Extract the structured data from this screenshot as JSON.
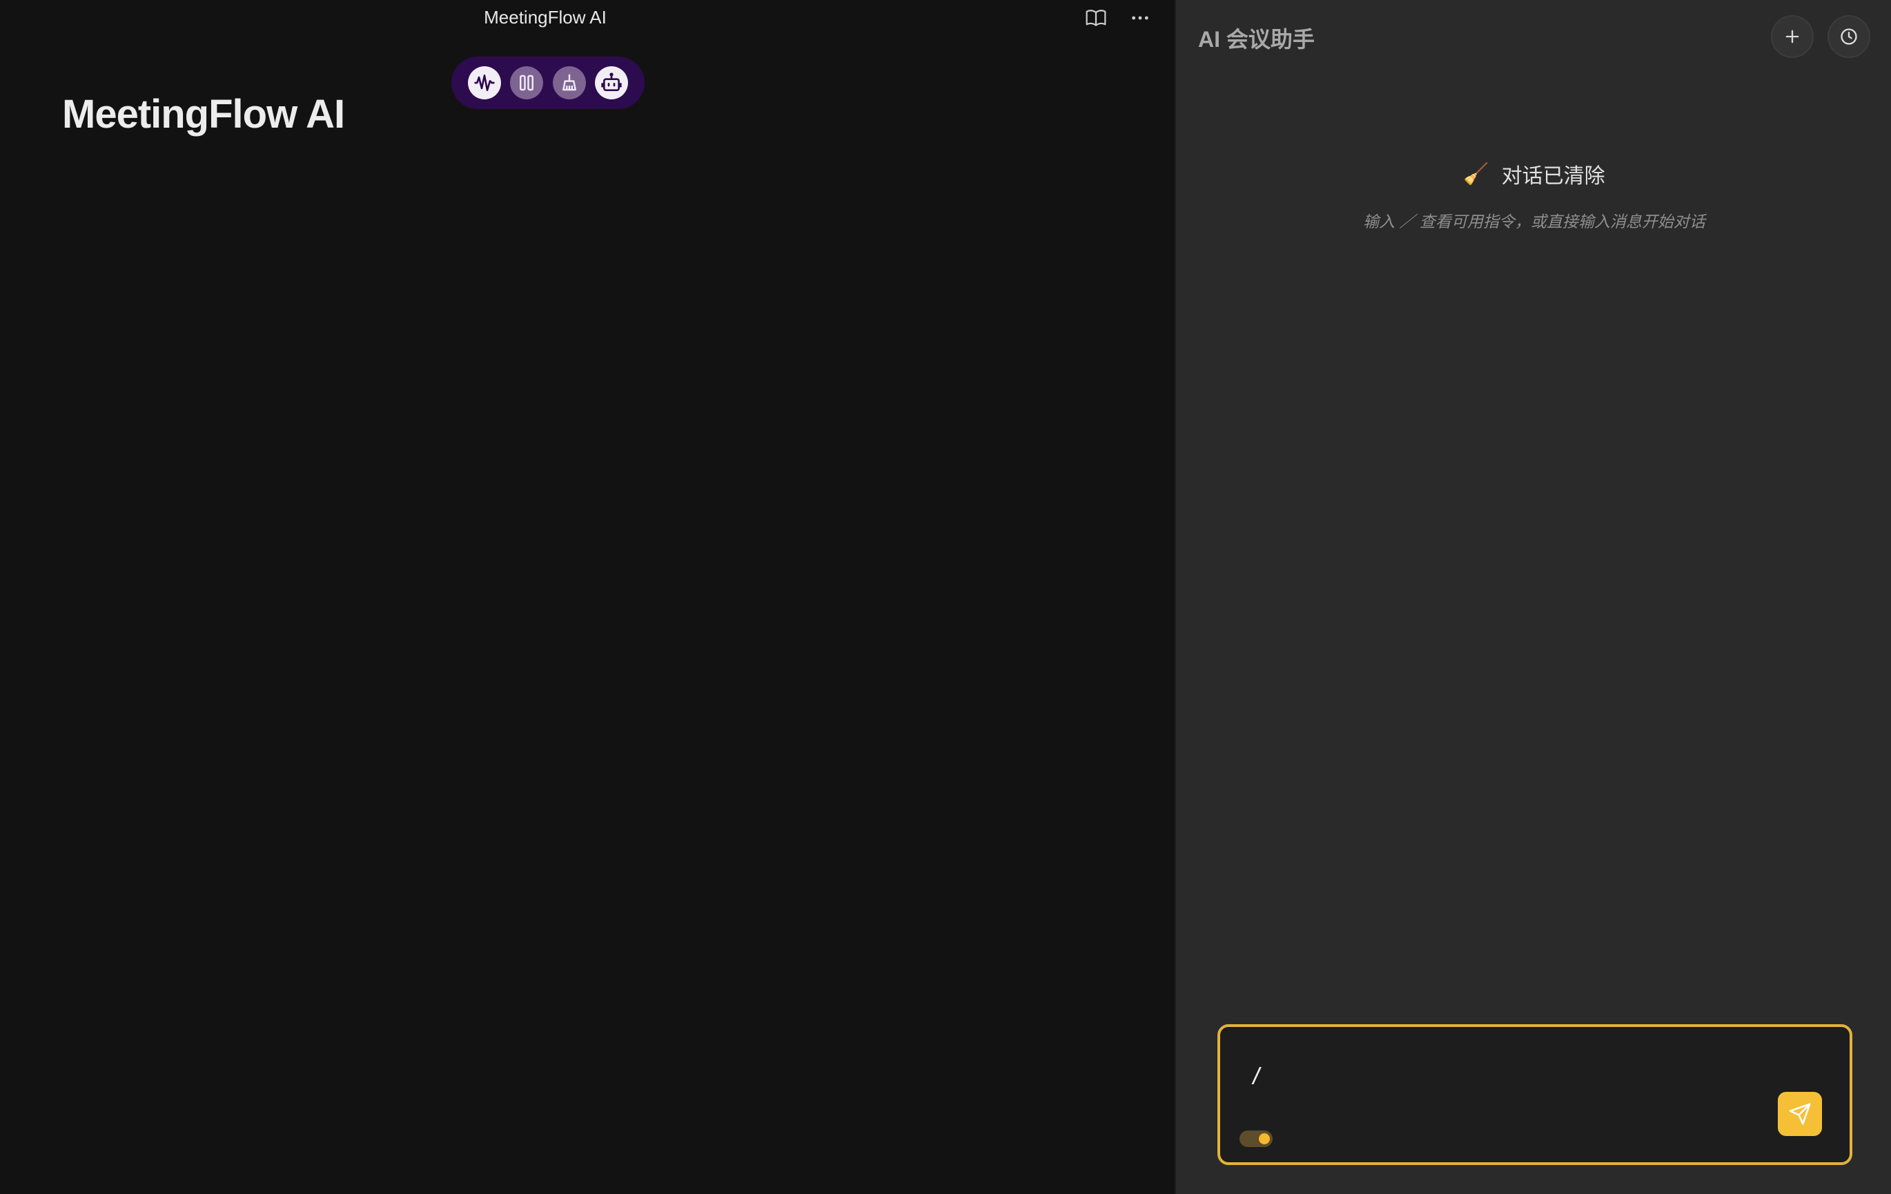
{
  "window": {
    "title": "MeetingFlow AI"
  },
  "editor": {
    "doc_title": "MeetingFlow AI",
    "top_actions": [
      {
        "icon": "book-open-icon"
      },
      {
        "icon": "more-horizontal-icon"
      }
    ],
    "toolbar": [
      {
        "icon": "audio-waveform-icon",
        "state": "active"
      },
      {
        "icon": "pause-icon",
        "state": "dim"
      },
      {
        "icon": "broom-icon",
        "state": "dim"
      },
      {
        "icon": "robot-icon",
        "state": "active"
      }
    ]
  },
  "panel": {
    "title": "AI 会议助手",
    "actions": [
      {
        "icon": "plus-icon"
      },
      {
        "icon": "clock-history-icon"
      }
    ],
    "empty_state": {
      "emoji": "🧹",
      "title": "对话已清除",
      "hint": "输入 ／ 查看可用指令，或直接输入消息开始对话"
    },
    "composer": {
      "value": "/",
      "placeholder": "",
      "toggle_on": true
    }
  },
  "colors": {
    "background": "#121212",
    "panel": "#2a2a2a",
    "toolbar": "#2d0b4f",
    "accent": "#f6c036",
    "composer_border": "#e3b23c"
  }
}
